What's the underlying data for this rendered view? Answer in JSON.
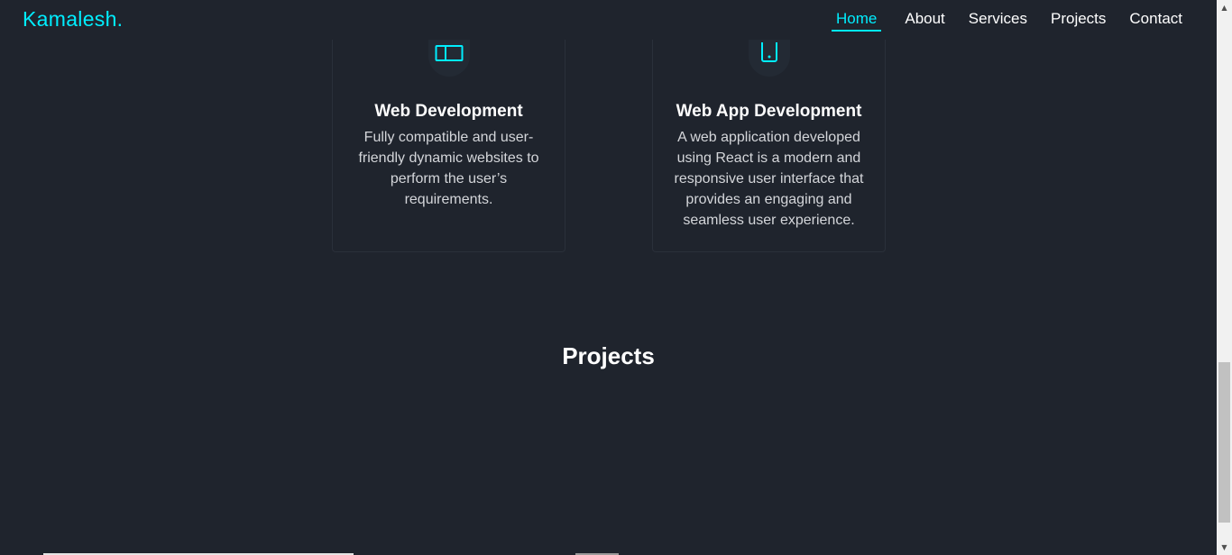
{
  "header": {
    "logo": "Kamalesh.",
    "nav": [
      {
        "label": "Home",
        "active": true
      },
      {
        "label": "About",
        "active": false
      },
      {
        "label": "Services",
        "active": false
      },
      {
        "label": "Projects",
        "active": false
      },
      {
        "label": "Contact",
        "active": false
      }
    ]
  },
  "services": [
    {
      "icon": "browser-window-icon",
      "title": "Web Development",
      "description": "Fully compatible and user-friendly dynamic websites to perform the user’s requirements."
    },
    {
      "icon": "mobile-phone-icon",
      "title": "Web App Development",
      "description": "A web application developed using React is a modern and responsive user interface that provides an engaging and seamless user experience."
    }
  ],
  "projects": {
    "title": "Projects"
  },
  "colors": {
    "background": "#1f242d",
    "accent": "#00eeff",
    "text": "#ffffff"
  }
}
